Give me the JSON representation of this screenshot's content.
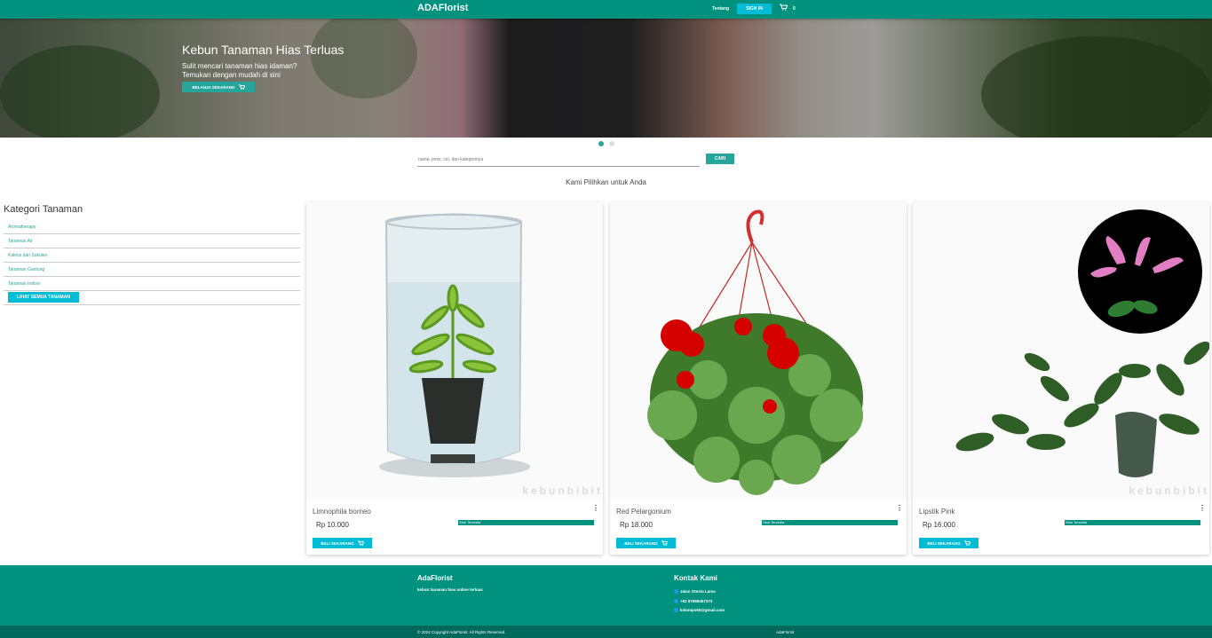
{
  "nav": {
    "brand": "ADAFlorist",
    "about": "Tentang",
    "sign_in": "SIGN IN",
    "cart_count": "0"
  },
  "hero": {
    "title": "Kebun Tanaman Hias Terluas",
    "subtitle_line1": "Sulit mencari tanaman hias idaman?",
    "subtitle_line2": "Temukan dengan mudah di sini",
    "cta": "BELANJA SEKARANG"
  },
  "carousel": {
    "active_index": 0,
    "count": 2,
    "active_color": "#26a69a",
    "inactive_color": "#cccccc"
  },
  "search": {
    "placeholder": "nama, jenis, ciri, dan kategorinya",
    "button": "CARI"
  },
  "section_title": "Kami Pilihkan untuk Anda",
  "categories": {
    "title": "Kategori Tanaman",
    "items": [
      {
        "label": "Aromatherapy"
      },
      {
        "label": "Tanaman Air"
      },
      {
        "label": "Kaktus dan Sukulen"
      },
      {
        "label": "Tanaman Gantung"
      },
      {
        "label": "Tanaman Indoor"
      }
    ],
    "see_all": "LIHAT SEMUA TANAMAN"
  },
  "products": [
    {
      "name": "Limnophila borneo",
      "price": "Rp 10.000",
      "stock": "Stok Tersedia",
      "buy": "BELI SEKARANG",
      "watermark": "kebunbibit"
    },
    {
      "name": "Red Pelargonium",
      "price": "Rp 18.000",
      "stock": "Stok Tersedia",
      "buy": "BELI SEKARANG",
      "watermark": ""
    },
    {
      "name": "Lipstik Pink",
      "price": "Rp 16.000",
      "stock": "Stok Tersedia",
      "buy": "BELI SEKARANG",
      "watermark": "kebunbibit"
    }
  ],
  "footer": {
    "brand": "AdaFlorist",
    "tagline": "kebun tanaman hias online terluas",
    "contact_title": "Kontak Kami",
    "address": "Jalan Otesta Lama",
    "phone": "+62 87868457373",
    "email": "kelompok5@gmail.com",
    "copyright": "© 2024 Copyright AdaFlorist. All Rights Reserved.",
    "bottom_brand": "AdaFlorist"
  },
  "colors": {
    "primary": "#00917f",
    "accent": "#00bcd4",
    "teal_button": "#26a69a",
    "footer_bottom": "#00695c"
  }
}
